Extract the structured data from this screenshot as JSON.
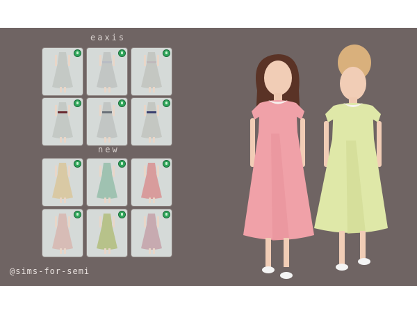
{
  "headings": {
    "eaxis": "eaxis",
    "new": "new"
  },
  "watermark": "@sims-for-semi",
  "thumbnails": {
    "eaxis": [
      {
        "bg": "#d5dad8",
        "dress": "#c4c9c5",
        "sash": "#c4c9c5"
      },
      {
        "bg": "#d5dad8",
        "dress": "#c2c6c4",
        "sash": "#b8bcc4"
      },
      {
        "bg": "#d5dad8",
        "dress": "#c4c7c2",
        "sash": "#bfb9bb"
      },
      {
        "bg": "#d5dad8",
        "dress": "#c4c9c5",
        "sash": "#6a2a30"
      },
      {
        "bg": "#d5dad8",
        "dress": "#c2c6c4",
        "sash": "#6a7078"
      },
      {
        "bg": "#d5dad8",
        "dress": "#c4c7c2",
        "sash": "#3b3f6e"
      }
    ],
    "new": [
      {
        "bg": "#d5dad8",
        "dress": "#d9c9a4",
        "sash": "#d9c9a4"
      },
      {
        "bg": "#d5dad8",
        "dress": "#9fc2b1",
        "sash": "#9fc2b1"
      },
      {
        "bg": "#d5dad8",
        "dress": "#d89c9c",
        "sash": "#d89c9c"
      },
      {
        "bg": "#d5dad8",
        "dress": "#d7bcb6",
        "sash": "#d7bcb6"
      },
      {
        "bg": "#d5dad8",
        "dress": "#b7c28a",
        "sash": "#b7c28a"
      },
      {
        "bg": "#d5dad8",
        "dress": "#c7aab0",
        "sash": "#c7aab0"
      }
    ]
  },
  "colors": {
    "panel": "#6f6463",
    "pink_dress": "#f0a1a8",
    "green_dress": "#dfe8a8",
    "hair_dark": "#5a3326",
    "hair_blonde": "#d9b07c",
    "skin": "#f1cdb6"
  }
}
